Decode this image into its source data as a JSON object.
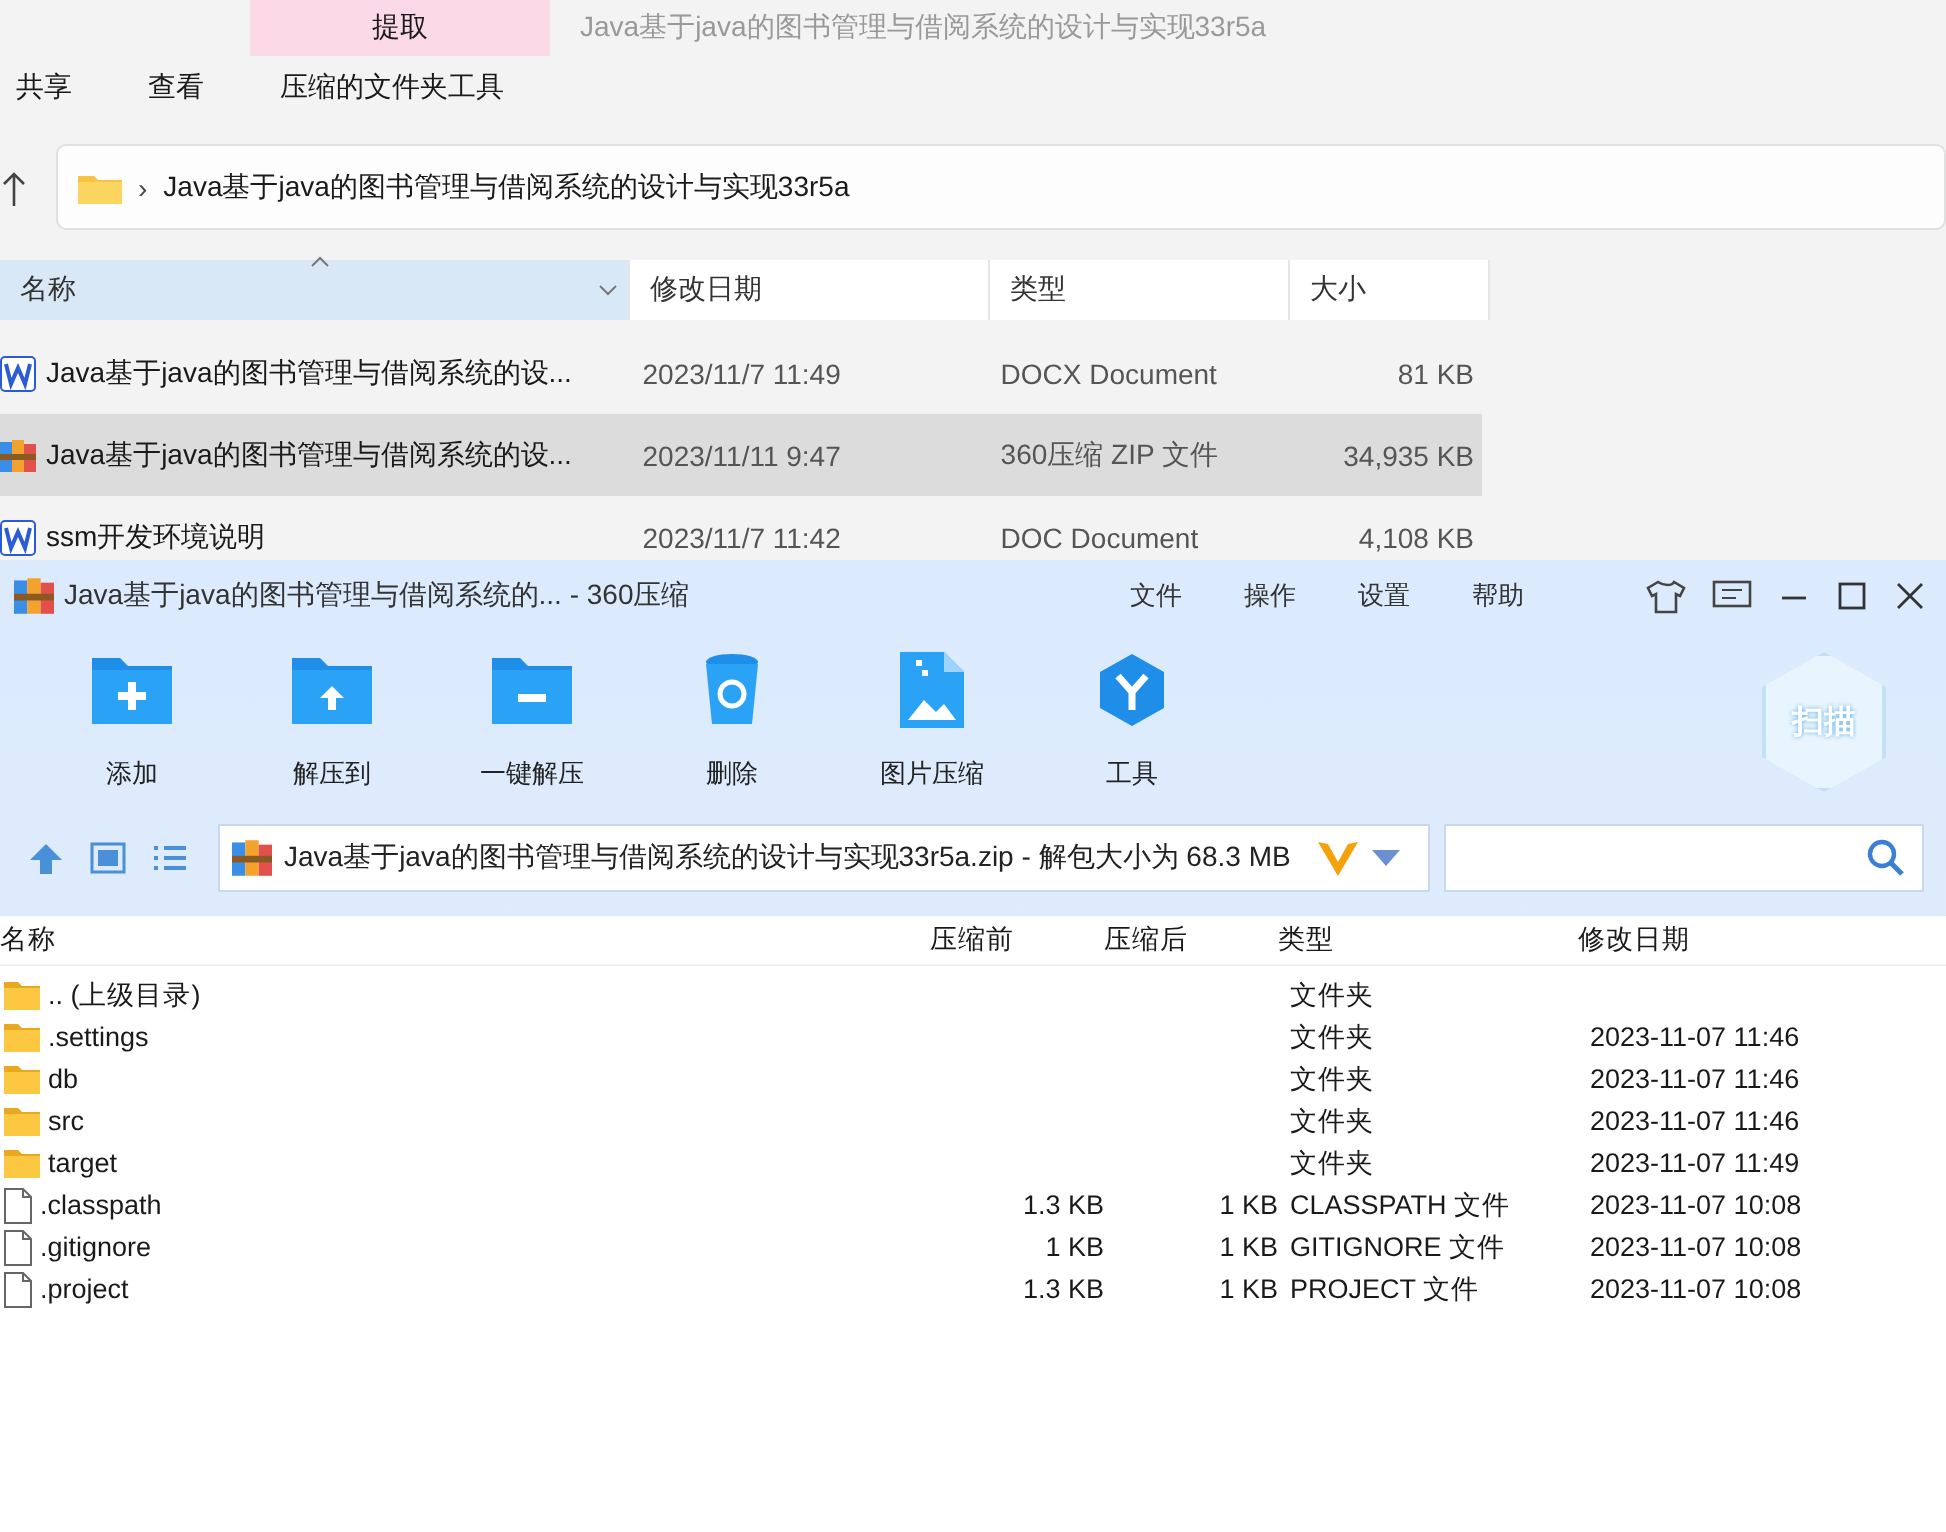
{
  "explorer": {
    "ribbon_tab": {
      "label": "提取",
      "selected": true
    },
    "title": "Java基于java的图书管理与借阅系统的设计与实现33r5a",
    "menu": [
      "共享",
      "查看",
      "压缩的文件夹工具"
    ],
    "breadcrumb_sep": "›",
    "breadcrumb": "Java基于java的图书管理与借阅系统的设计与实现33r5a",
    "columns": [
      "名称",
      "修改日期",
      "类型",
      "大小"
    ],
    "rows": [
      {
        "kind": "word",
        "name": "Java基于java的图书管理与借阅系统的设...",
        "date": "2023/11/7 11:49",
        "type": "DOCX Document",
        "size": "81 KB",
        "selected": false
      },
      {
        "kind": "zip",
        "name": "Java基于java的图书管理与借阅系统的设...",
        "date": "2023/11/11 9:47",
        "type": "360压缩 ZIP 文件",
        "size": "34,935 KB",
        "selected": true
      },
      {
        "kind": "word",
        "name": "ssm开发环境说明",
        "date": "2023/11/7 11:42",
        "type": "DOC Document",
        "size": "4,108 KB",
        "selected": false
      }
    ]
  },
  "archiver": {
    "title": "Java基于java的图书管理与借阅系统的... - 360压缩",
    "menu": [
      "文件",
      "操作",
      "设置",
      "帮助"
    ],
    "tools": [
      {
        "kind": "add",
        "label": "添加"
      },
      {
        "kind": "extract",
        "label": "解压到"
      },
      {
        "kind": "oneclick",
        "label": "一键解压"
      },
      {
        "kind": "delete",
        "label": "删除"
      },
      {
        "kind": "image",
        "label": "图片压缩"
      },
      {
        "kind": "tools",
        "label": "工具"
      }
    ],
    "scan_label": "扫描",
    "path": "Java基于java的图书管理与借阅系统的设计与实现33r5a.zip - 解包大小为 68.3 MB",
    "columns": [
      "名称",
      "压缩前",
      "压缩后",
      "类型",
      "修改日期"
    ],
    "rows": [
      {
        "kind": "folder",
        "name": ".. (上级目录)",
        "type": "文件夹"
      },
      {
        "kind": "folder",
        "name": ".settings",
        "type": "文件夹",
        "date": "2023-11-07 11:46"
      },
      {
        "kind": "folder",
        "name": "db",
        "type": "文件夹",
        "date": "2023-11-07 11:46"
      },
      {
        "kind": "folder",
        "name": "src",
        "type": "文件夹",
        "date": "2023-11-07 11:46"
      },
      {
        "kind": "folder",
        "name": "target",
        "type": "文件夹",
        "date": "2023-11-07 11:49"
      },
      {
        "kind": "file",
        "name": ".classpath",
        "before": "1.3 KB",
        "after": "1 KB",
        "type": "CLASSPATH 文件",
        "date": "2023-11-07 10:08"
      },
      {
        "kind": "file",
        "name": ".gitignore",
        "before": "1 KB",
        "after": "1 KB",
        "type": "GITIGNORE 文件",
        "date": "2023-11-07 10:08"
      },
      {
        "kind": "file",
        "name": ".project",
        "before": "1.3 KB",
        "after": "1 KB",
        "type": "PROJECT 文件",
        "date": "2023-11-07 10:08"
      }
    ]
  }
}
